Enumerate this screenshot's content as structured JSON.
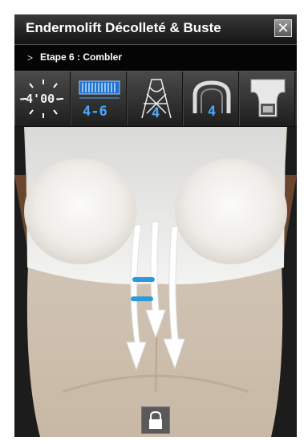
{
  "window": {
    "title": "Endermolift Décolleté & Buste",
    "close_label": "✕"
  },
  "step": {
    "chevron": ">",
    "label": "Etape 6 : Combler"
  },
  "toolbar": {
    "timer": "-4'00-",
    "intensity": "4-6",
    "roller_value": "4",
    "head_value": "4"
  },
  "colors": {
    "accent": "#4aa8ff",
    "arrow": "#ffffff",
    "marker": "#2a9bd8"
  },
  "icons": [
    "timer-icon",
    "intensity-icon",
    "roller-icon",
    "head-icon",
    "treatment-head-icon",
    "lock-icon",
    "close-icon"
  ]
}
